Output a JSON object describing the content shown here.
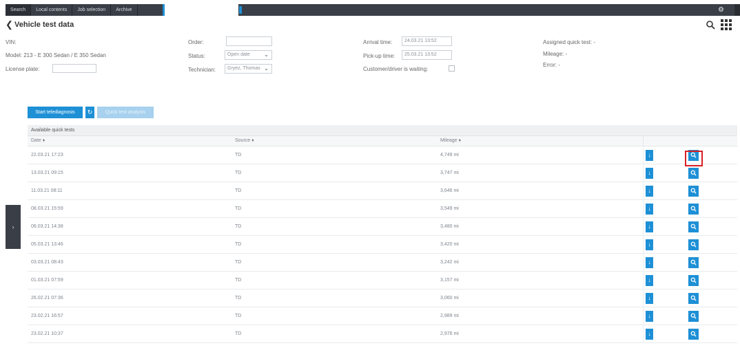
{
  "topbar": {
    "tabs": [
      "Search",
      "Local contents",
      "Job selection",
      "Archive"
    ],
    "settings_icon": "gear-icon"
  },
  "header": {
    "back_icon": "chevron-left-icon",
    "title": "Vehicle test data",
    "search_icon": "search-icon",
    "apps_icon": "grid-icon"
  },
  "vehicle": {
    "vin_label": "VIN:",
    "model": "Model: 213 - E 300 Sedan / E 350 Sedan",
    "license_label": "License plate:",
    "license_value": ""
  },
  "order": {
    "order_label": "Order:",
    "order_value": "",
    "status_label": "Status:",
    "status_value": "Open date",
    "technician_label": "Technician:",
    "technician_value": "Gryez, Thomas"
  },
  "times": {
    "arrival_label": "Arrival time:",
    "arrival_value": "24.03.21 13:52",
    "pickup_label": "Pick-up time:",
    "pickup_value": "25.03.21 13:52",
    "waiting_label": "Customer/driver is waiting:"
  },
  "summary": {
    "quick_test": "Assigned quick test: -",
    "mileage": "Mileage: -",
    "error": "Error: -"
  },
  "actions": {
    "start_label": "Start telediagnosis",
    "refresh_icon": "refresh-icon",
    "analysis_label": "Quick test analysis"
  },
  "table": {
    "title": "Available quick tests",
    "columns": [
      "Date",
      "Source",
      "Mileage"
    ],
    "rows": [
      {
        "date": "22.03.21 17:23",
        "source": "TD",
        "mileage": "4,749 mi"
      },
      {
        "date": "13.03.21 09:15",
        "source": "TD",
        "mileage": "3,747 mi"
      },
      {
        "date": "11.03.21 08:11",
        "source": "TD",
        "mileage": "3,646 mi"
      },
      {
        "date": "08.03.21 15:59",
        "source": "TD",
        "mileage": "3,549 mi"
      },
      {
        "date": "06.03.21 14:38",
        "source": "TD",
        "mileage": "3,480 mi"
      },
      {
        "date": "05.03.21 13:46",
        "source": "TD",
        "mileage": "3,420 mi"
      },
      {
        "date": "03.03.21 08:43",
        "source": "TD",
        "mileage": "3,242 mi"
      },
      {
        "date": "01.03.21 07:59",
        "source": "TD",
        "mileage": "3,157 mi"
      },
      {
        "date": "26.02.21 07:36",
        "source": "TD",
        "mileage": "3,060 mi"
      },
      {
        "date": "23.02.21 16:57",
        "source": "TD",
        "mileage": "2,989 mi"
      },
      {
        "date": "23.02.21 10:37",
        "source": "TD",
        "mileage": "2,976 mi"
      }
    ]
  },
  "colors": {
    "accent": "#1e90d6",
    "topbar": "#3a3f47",
    "highlight": "#d81e25"
  }
}
